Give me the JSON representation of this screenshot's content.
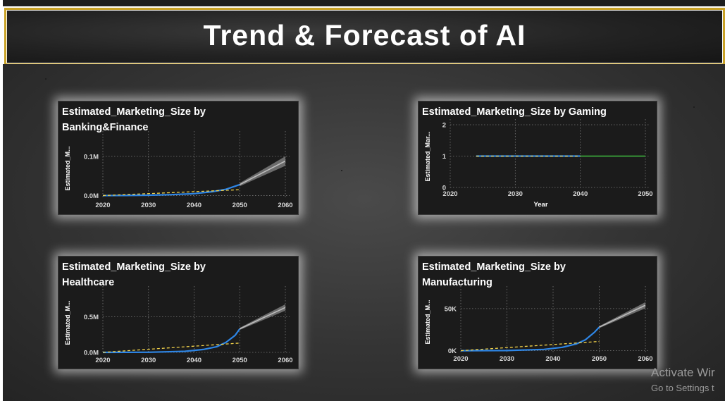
{
  "page": {
    "title": "Trend & Forecast of AI"
  },
  "watermark": {
    "line1": "Activate Wir",
    "line2": "Go to Settings t"
  },
  "colors": {
    "actual": "#2e86e6",
    "trend": "#f2d24a",
    "forecast": "#bdbdbd",
    "flat_forecast": "#3fbf3f",
    "accent": "#c9a227"
  },
  "chart_data": [
    {
      "id": "banking",
      "type": "line",
      "title_line1": "Estimated_Marketing_Size by",
      "title_line2": "Banking&Finance",
      "ylabel": "Estimated_M...",
      "xlabel": "",
      "xticks": [
        "2020",
        "2030",
        "2040",
        "2050",
        "2060"
      ],
      "yticks": [
        {
          "v": 0,
          "label": "0.0M"
        },
        {
          "v": 100000,
          "label": "0.1M"
        }
      ],
      "xlim": [
        2020,
        2060
      ],
      "ylim": [
        -8000,
        150000
      ],
      "series": [
        {
          "role": "actual",
          "x": [
            2020,
            2025,
            2030,
            2035,
            2040,
            2044,
            2047,
            2050
          ],
          "y": [
            0,
            300,
            1000,
            2500,
            5000,
            10000,
            16000,
            28000
          ]
        },
        {
          "role": "trend",
          "x": [
            2020,
            2050
          ],
          "y": [
            0,
            15000
          ]
        },
        {
          "role": "forecast",
          "x": [
            2050,
            2055,
            2060
          ],
          "y": [
            28000,
            58000,
            88000
          ],
          "band": [
            4000,
            8000,
            12000
          ]
        }
      ]
    },
    {
      "id": "gaming",
      "type": "line",
      "title_line1": "Estimated_Marketing_Size by Gaming",
      "title_line2": "",
      "ylabel": "Estimated_Mar...",
      "xlabel": "Year",
      "xticks": [
        "2020",
        "2030",
        "2040",
        "2050"
      ],
      "yticks": [
        {
          "v": 0,
          "label": "0"
        },
        {
          "v": 1,
          "label": "1"
        },
        {
          "v": 2,
          "label": "2"
        }
      ],
      "xlim": [
        2020,
        2050
      ],
      "ylim": [
        0,
        2
      ],
      "series": [
        {
          "role": "actual",
          "x": [
            2024,
            2040
          ],
          "y": [
            1,
            1
          ]
        },
        {
          "role": "trend",
          "x": [
            2024,
            2040
          ],
          "y": [
            1,
            1
          ]
        },
        {
          "role": "flat_forecast",
          "x": [
            2040,
            2050
          ],
          "y": [
            1,
            1
          ]
        }
      ]
    },
    {
      "id": "healthcare",
      "type": "line",
      "title_line1": "Estimated_Marketing_Size by",
      "title_line2": "Healthcare",
      "ylabel": "Estimated_M...",
      "xlabel": "",
      "xticks": [
        "2020",
        "2030",
        "2040",
        "2050",
        "2060"
      ],
      "yticks": [
        {
          "v": 0,
          "label": "0.0M"
        },
        {
          "v": 500000,
          "label": "0.5M"
        }
      ],
      "xlim": [
        2020,
        2060
      ],
      "ylim": [
        -20000,
        850000
      ],
      "series": [
        {
          "role": "actual",
          "x": [
            2020,
            2030,
            2038,
            2042,
            2045,
            2047,
            2049,
            2050
          ],
          "y": [
            0,
            2000,
            15000,
            40000,
            80000,
            140000,
            240000,
            330000
          ]
        },
        {
          "role": "trend",
          "x": [
            2020,
            2050
          ],
          "y": [
            0,
            130000
          ]
        },
        {
          "role": "forecast",
          "x": [
            2050,
            2055,
            2060
          ],
          "y": [
            330000,
            480000,
            630000
          ],
          "band": [
            15000,
            30000,
            45000
          ]
        }
      ]
    },
    {
      "id": "manufacturing",
      "type": "line",
      "title_line1": "Estimated_Marketing_Size by",
      "title_line2": "Manufacturing",
      "ylabel": "Estimated_M...",
      "xlabel": "",
      "xticks": [
        "2020",
        "2030",
        "2040",
        "2050",
        "2060"
      ],
      "yticks": [
        {
          "v": 0,
          "label": "0K"
        },
        {
          "v": 50000,
          "label": "50K"
        }
      ],
      "xlim": [
        2020,
        2060
      ],
      "ylim": [
        -2000,
        70000
      ],
      "series": [
        {
          "role": "actual",
          "x": [
            2020,
            2030,
            2038,
            2042,
            2045,
            2047,
            2049,
            2050
          ],
          "y": [
            0,
            200,
            1500,
            4000,
            8000,
            13000,
            22000,
            28000
          ]
        },
        {
          "role": "trend",
          "x": [
            2020,
            2050
          ],
          "y": [
            0,
            11000
          ]
        },
        {
          "role": "forecast",
          "x": [
            2050,
            2055,
            2060
          ],
          "y": [
            28000,
            41000,
            54000
          ],
          "band": [
            1200,
            2400,
            3600
          ]
        }
      ]
    }
  ]
}
